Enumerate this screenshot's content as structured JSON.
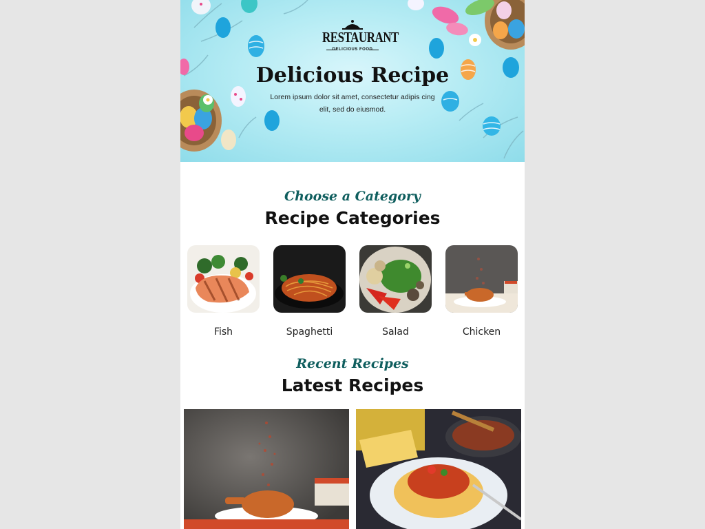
{
  "hero": {
    "logo_text": "RESTAURANT",
    "logo_tagline": "DELICIOUS FOOD",
    "title": "Delicious Recipe",
    "description": "Lorem ipsum dolor sit amet, consectetur adipis cing elit, sed do eiusmod."
  },
  "categories_section": {
    "script_heading": "Choose a Category",
    "title": "Recipe Categories",
    "items": [
      {
        "label": "Fish",
        "image": "grilled-salmon-photo"
      },
      {
        "label": "Spaghetti",
        "image": "spaghetti-plate-photo"
      },
      {
        "label": "Salad",
        "image": "salad-bowl-photo"
      },
      {
        "label": "Chicken",
        "image": "fried-chicken-photo"
      }
    ]
  },
  "recipes_section": {
    "script_heading": "Recent Recipes",
    "title": "Latest Recipes",
    "items": [
      {
        "image": "fried-chicken-spice-photo"
      },
      {
        "image": "penne-pasta-cheese-photo"
      }
    ]
  },
  "colors": {
    "background": "#e6e6e6",
    "hero": "#b6ecf4",
    "script_accent": "#0f5e5e",
    "text": "#111111"
  }
}
